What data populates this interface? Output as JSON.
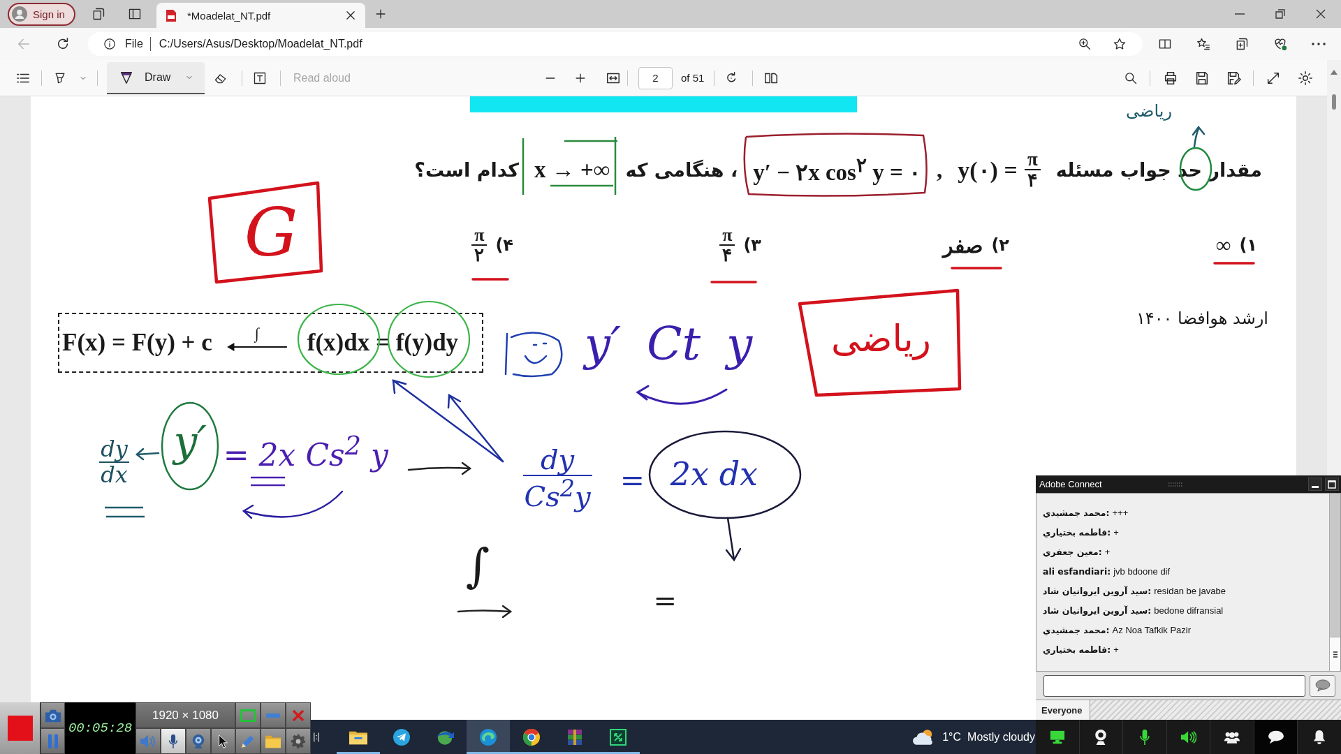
{
  "browser": {
    "sign_in": "Sign in",
    "tabs": [
      {
        "title": "*Moadelat_NT.pdf",
        "selected": true
      }
    ],
    "back_disabled": true,
    "address": {
      "scheme": "File",
      "url": "C:/Users/Asus/Desktop/Moadelat_NT.pdf"
    }
  },
  "pdf_toolbar": {
    "draw": {
      "label": "Draw",
      "selected": true
    },
    "read_aloud": {
      "label": "Read aloud",
      "disabled": true
    },
    "page": "2",
    "page_count": "of 51"
  },
  "document": {
    "question": [
      {
        "kind": "text",
        "text": "مقدار حد جواب مسئله"
      },
      {
        "kind": "fraction_eq",
        "lhs": "y(۰) =",
        "num": "π",
        "den": "۴"
      },
      {
        "kind": "math",
        "text": ","
      },
      {
        "kind": "math",
        "text": "y′ − ۲x cos$^{۲}$ y = ۰"
      },
      {
        "kind": "text",
        "text": "، هنگامی که"
      },
      {
        "kind": "math",
        "text": "x → +∞"
      },
      {
        "kind": "text",
        "text": "کدام است؟"
      }
    ],
    "options": [
      {
        "label": "۱)",
        "kind": "text",
        "value": "∞"
      },
      {
        "label": "۲)",
        "kind": "text",
        "value": "صفر"
      },
      {
        "label": "۳)",
        "kind": "fraction",
        "num": "π",
        "den": "۴"
      },
      {
        "label": "۴)",
        "kind": "fraction",
        "num": "π",
        "den": "۲"
      }
    ],
    "source": "ارشد هوافضا ۱۴۰۰",
    "formula": {
      "left": "F(x) = F(y) + c",
      "arrow_label": "∫",
      "right": "f(x)dx = f(y)dy"
    },
    "ink_words": [
      {
        "text": "ریاضی",
        "color": "#1e5b6b"
      },
      {
        "text": "ریاضی",
        "color": "#d3121c"
      }
    ],
    "ink_notes": [
      {
        "kind": "text",
        "text": "G",
        "color": "#d3121c"
      },
      {
        "kind": "text",
        "text": "y′ Ct y",
        "color": "#3a1fae"
      },
      {
        "kind": "text",
        "text": "2x dx",
        "color": "#2232b0"
      },
      {
        "kind": "text",
        "text": "=",
        "color": "#2232b0"
      },
      {
        "kind": "fraction",
        "num": "dy",
        "den": "Cs$^{2}$y",
        "color": "#2232b0"
      },
      {
        "kind": "text",
        "text": "= 2x Cs$^{2}$ y",
        "color": "#4a1fb0"
      },
      {
        "kind": "text",
        "text": "y′",
        "color": "#1c6f3a"
      },
      {
        "kind": "fraction",
        "num": "dy",
        "den": "dx",
        "color": "#1e5160"
      },
      {
        "kind": "text",
        "text": "∫",
        "color": "#1a1a1a"
      },
      {
        "kind": "text",
        "text": "=",
        "color": "#1a1a1a"
      }
    ]
  },
  "chat": {
    "title": "Adobe Connect",
    "messages": [
      {
        "sender": "محمد جمشيدي:",
        "text": "+++"
      },
      {
        "sender": "فاطمه بختياري:",
        "text": "+"
      },
      {
        "sender": "معين جعفري:",
        "text": "+"
      },
      {
        "sender": "ali esfandiari:",
        "text": "jvb bdoone dif"
      },
      {
        "sender": "سيد آروين ايروانيان شاد:",
        "text": "residan be javabe"
      },
      {
        "sender": "سيد آروين ايروانيان شاد:",
        "text": "bedone difransial"
      },
      {
        "sender": "محمد جمشيدي:",
        "text": "Az Noa Tafkik Pazir"
      },
      {
        "sender": "فاطمه بختياري:",
        "text": "+"
      }
    ],
    "audience_tab": {
      "label": "Everyone",
      "selected": true
    },
    "controls": [
      {
        "kind": "screen_share",
        "on": true,
        "selected": false
      },
      {
        "kind": "camera",
        "on": false,
        "selected": false
      },
      {
        "kind": "microphone",
        "on": true,
        "selected": false
      },
      {
        "kind": "speaker",
        "on": true,
        "selected": false
      },
      {
        "kind": "attendees",
        "on": false,
        "selected": false
      },
      {
        "kind": "chat",
        "on": false,
        "selected": true
      },
      {
        "kind": "notifications",
        "on": false,
        "selected": false
      }
    ]
  },
  "recorder": {
    "elapsed": "00:05:28",
    "resolution": "1920 × 1080",
    "tools": [
      {
        "kind": "speaker",
        "selected": false
      },
      {
        "kind": "microphone",
        "selected": true
      },
      {
        "kind": "webcam",
        "selected": false
      },
      {
        "kind": "cursor",
        "selected": false
      },
      {
        "kind": "pencil",
        "selected": false
      },
      {
        "kind": "folder",
        "selected": false
      },
      {
        "kind": "settings",
        "selected": false
      }
    ]
  },
  "taskbar": {
    "apps": [
      {
        "kind": "file_explorer",
        "running": true,
        "selected": false
      },
      {
        "kind": "telegram",
        "running": false,
        "selected": false
      },
      {
        "kind": "download_manager",
        "running": false,
        "selected": false
      },
      {
        "kind": "edge",
        "running": true,
        "selected": true
      },
      {
        "kind": "chrome",
        "running": true,
        "selected": false
      },
      {
        "kind": "winrar",
        "running": true,
        "selected": false
      },
      {
        "kind": "remote_app",
        "running": true,
        "selected": false
      }
    ],
    "weather": {
      "temperature": "1°C",
      "condition": "Mostly cloudy"
    }
  }
}
